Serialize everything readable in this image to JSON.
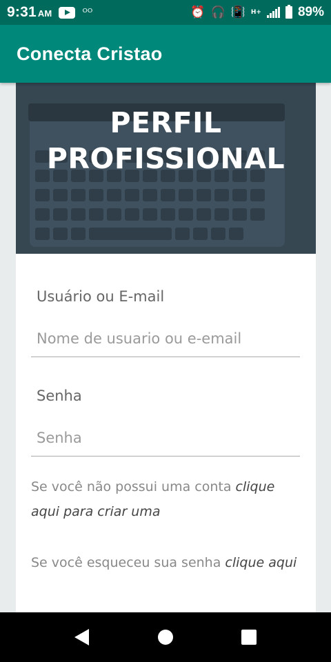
{
  "status": {
    "time": "9:31",
    "ampm": "AM",
    "battery_pct": "89%",
    "net_type": "H+"
  },
  "app": {
    "title": "Conecta Cristao",
    "accent": "#00897b",
    "status_bar_color": "#006b5d"
  },
  "hero": {
    "title_line1": "PERFIL",
    "title_line2": "PROFISSIONAL"
  },
  "form": {
    "user_label": "Usuário ou E-mail",
    "user_placeholder": "Nome de usuario ou e-email",
    "pass_label": "Senha",
    "pass_placeholder": "Senha"
  },
  "hints": {
    "register_text": "Se você não possui uma conta ",
    "register_link": "clique aqui para criar uma",
    "forgot_text": "Se você esqueceu sua senha ",
    "forgot_link": "clique aqui"
  },
  "icons": [
    "youtube-icon",
    "voicemail-icon",
    "alarm-icon",
    "headset-icon",
    "vibrate-icon",
    "signal-icon",
    "battery-icon",
    "back-icon",
    "home-icon",
    "recents-icon"
  ]
}
